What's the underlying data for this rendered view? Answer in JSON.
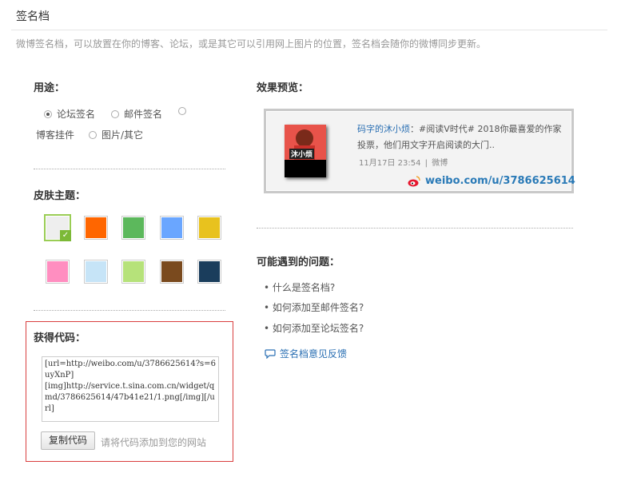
{
  "header": {
    "title": "签名档",
    "description": "微博签名档，可以放置在你的博客、论坛，或是其它可以引用网上图片的位置，签名档会随你的微博同步更新。"
  },
  "usage": {
    "title": "用途：",
    "options": [
      {
        "label": "论坛签名",
        "selected": true
      },
      {
        "label": "邮件签名",
        "selected": false
      },
      {
        "label": "博客挂件",
        "selected": false
      },
      {
        "label": "图片/其它",
        "selected": false
      }
    ]
  },
  "skins": {
    "title": "皮肤主题：",
    "selected_index": 0,
    "check_mark": "✓",
    "colors": [
      "#eeeeee",
      "#ff6600",
      "#5cb85c",
      "#6aa6ff",
      "#e8c21e",
      "#ff8ec0",
      "#c6e4f7",
      "#b6e27a",
      "#7a4a1e",
      "#1a3d5c"
    ]
  },
  "code": {
    "title": "获得代码：",
    "value": "[url=http://weibo.com/u/3786625614?s=6uyXnP]\n[img]http://service.t.sina.com.cn/widget/qmd/3786625614/47b41e21/1.png[/img][/url]",
    "copy_label": "复制代码",
    "hint": "请将代码添加到您的网站"
  },
  "preview": {
    "title": "效果预览：",
    "username": "码字的沐小烦",
    "colon": "：",
    "post_text": "#阅读V时代# 2018你最喜爱的作家投票，他们用文字开启阅读的大门..",
    "time": "11月17日 23:54",
    "separator": "|",
    "source": "微博",
    "url": "weibo.com/u/3786625614",
    "avatar_label": "沐小烦"
  },
  "problems": {
    "title": "可能遇到的问题：",
    "items": [
      "什么是签名档?",
      "如何添加至邮件签名?",
      "如何添加至论坛签名?"
    ],
    "feedback": "签名档意见反馈"
  },
  "colors": {
    "accent_link": "#2a6fb3",
    "code_border": "#d93f3f",
    "selected_skin": "#7cb937"
  }
}
